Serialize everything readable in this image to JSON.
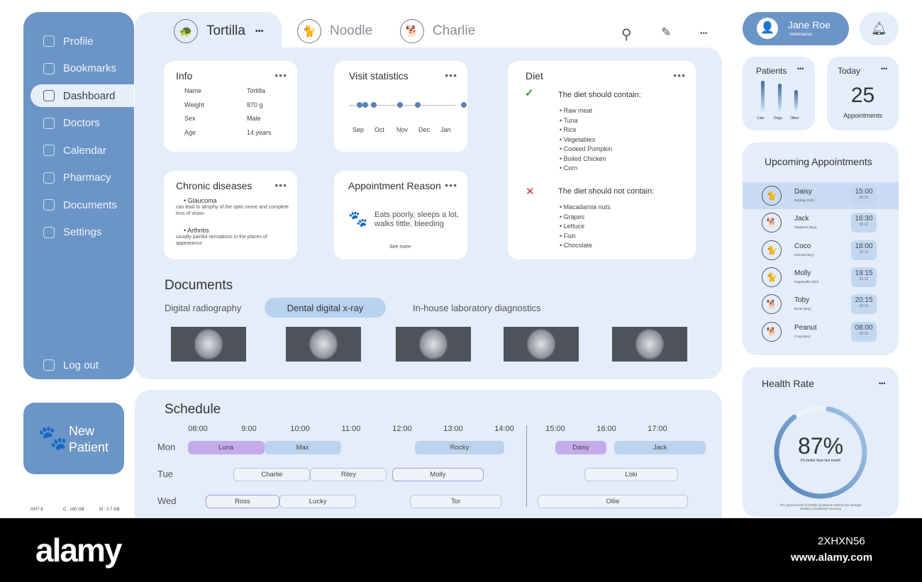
{
  "sidebar": {
    "items": [
      {
        "label": "Profile"
      },
      {
        "label": "Bookmarks"
      },
      {
        "label": "Dashboard"
      },
      {
        "label": "Doctors"
      },
      {
        "label": "Calendar"
      },
      {
        "label": "Pharmacy"
      },
      {
        "label": "Documents"
      },
      {
        "label": "Settings"
      }
    ],
    "logout": "Log out"
  },
  "new_patient": {
    "line1": "New",
    "line2": "Patient"
  },
  "system": {
    "gpu": "GHT-8",
    "c": "C : 180 GB",
    "m": "M : 2.7 GB"
  },
  "tabs": [
    {
      "label": "Tortilla",
      "icon": "turtle-icon"
    },
    {
      "label": "Noodle",
      "icon": "cat-icon"
    },
    {
      "label": "Charlie",
      "icon": "dog-icon"
    }
  ],
  "more": "•••",
  "info": {
    "title": "Info",
    "rows": [
      [
        "Name",
        "Tortilla"
      ],
      [
        "Weight",
        "870 g"
      ],
      [
        "Sex",
        "Male"
      ],
      [
        "Age",
        "14 years"
      ]
    ]
  },
  "visits": {
    "title": "Visit statistics",
    "months": [
      "Sep",
      "Oct",
      "Nov",
      "Dec",
      "Jan"
    ],
    "visit_positions": [
      0.1,
      0.35,
      0.75,
      1.95,
      2.75,
      4.85
    ]
  },
  "diet": {
    "title": "Diet",
    "contain_title": "The diet should contain:",
    "contain": [
      "Raw meat",
      "Tuna",
      "Rice",
      "Vegetables",
      "Cooked Pumpkin",
      "Boiled Chicken",
      "Corn"
    ],
    "not_title": "The diet should not contain:",
    "not": [
      "Macadamia nuts",
      "Grapes",
      "Lettuce",
      "Fish",
      "Chocolate"
    ],
    "check_color": "#2e9b3e",
    "cross_color": "#c0303a"
  },
  "chronic": {
    "title": "Chronic diseases",
    "items": [
      {
        "name": "Glaucoma",
        "desc": "can lead to atrophy of the optic nerve and complete loss of vision"
      },
      {
        "name": "Arthritis",
        "desc": "usually painful sensations in the places of appearance"
      }
    ]
  },
  "reason": {
    "title": "Appointment Reason",
    "text": "Eats poorly, sleeps a lot, walks little, bleeding",
    "see_more": "See more"
  },
  "documents": {
    "title": "Documents",
    "tabs": [
      "Digital radiography",
      "Dental digital x-ray",
      "In-house laboratory diagnostics"
    ],
    "active": 1
  },
  "schedule": {
    "title": "Schedule",
    "hours": [
      "08:00",
      "9:00",
      "10:00",
      "11:00",
      "12:00",
      "13:00",
      "14:00",
      "15:00",
      "16:00",
      "17:00"
    ],
    "days": [
      "Mon",
      "Tue",
      "Wed"
    ],
    "events": [
      {
        "day": 0,
        "name": "Luna",
        "start": 7.8,
        "end": 9.3,
        "style": "purple"
      },
      {
        "day": 0,
        "name": "Max",
        "start": 9.3,
        "end": 10.8,
        "style": "blue"
      },
      {
        "day": 0,
        "name": "Rocky",
        "start": 12.25,
        "end": 14.0,
        "style": "blue"
      },
      {
        "day": 0,
        "name": "Daisy",
        "start": 15.0,
        "end": 16.0,
        "style": "purple"
      },
      {
        "day": 0,
        "name": "Jack",
        "start": 16.15,
        "end": 17.95,
        "style": "blue"
      },
      {
        "day": 1,
        "name": "Charlie",
        "start": 8.7,
        "end": 10.2,
        "style": "outline"
      },
      {
        "day": 1,
        "name": "Riley",
        "start": 10.2,
        "end": 11.7,
        "style": "outline"
      },
      {
        "day": 1,
        "name": "Molly",
        "start": 11.8,
        "end": 13.6,
        "style": "outline p"
      },
      {
        "day": 1,
        "name": "Loki",
        "start": 15.57,
        "end": 17.4,
        "style": "outline"
      },
      {
        "day": 2,
        "name": "Ross",
        "start": 8.15,
        "end": 9.6,
        "style": "outline p"
      },
      {
        "day": 2,
        "name": "Lucky",
        "start": 9.6,
        "end": 11.1,
        "style": "outline"
      },
      {
        "day": 2,
        "name": "Tor",
        "start": 12.15,
        "end": 13.95,
        "style": "outline"
      },
      {
        "day": 2,
        "name": "Ollie",
        "start": 14.65,
        "end": 17.6,
        "style": "outline"
      }
    ]
  },
  "user": {
    "name": "Jane Roe",
    "role": "Veterinarian"
  },
  "patients": {
    "title": "Patients",
    "bars": [
      {
        "label": "Cats",
        "value": 1.0
      },
      {
        "label": "Dogs",
        "value": 0.9
      },
      {
        "label": "Other",
        "value": 0.7
      }
    ]
  },
  "today": {
    "title": "Today",
    "count": "25",
    "label": "Appointments"
  },
  "upcoming": {
    "title": "Upcoming Appointments",
    "items": [
      {
        "name": "Daisy",
        "breed": "Bombay (Girl)",
        "time": "15:00",
        "date": "02.12",
        "icon": "cat-icon"
      },
      {
        "name": "Jack",
        "breed": "Shepherd (Boy)",
        "time": "16:30",
        "date": "02.12",
        "icon": "dog-icon"
      },
      {
        "name": "Coco",
        "breed": "Oriental (Boy)",
        "time": "18:00",
        "date": "02.12",
        "icon": "cat-icon"
      },
      {
        "name": "Molly",
        "breed": "Ragamuffin (Girl)",
        "time": "19:15",
        "date": "02.12",
        "icon": "cat-icon"
      },
      {
        "name": "Toby",
        "breed": "Boxer (Boy)",
        "time": "20:15",
        "date": "02.12",
        "icon": "dog-icon"
      },
      {
        "name": "Peanut",
        "breed": "Corgi (Boy)",
        "time": "08:00",
        "date": "03.12",
        "icon": "dog-icon"
      }
    ]
  },
  "health": {
    "title": "Health Rate",
    "value": "87%",
    "percent": 87,
    "sub": "2% better than last month",
    "note": "The general level of health of patients reflects the average statistics of patients' recovery"
  },
  "footer": {
    "logo": "alamy",
    "id": "2XHXN56",
    "url": "www.alamy.com"
  }
}
